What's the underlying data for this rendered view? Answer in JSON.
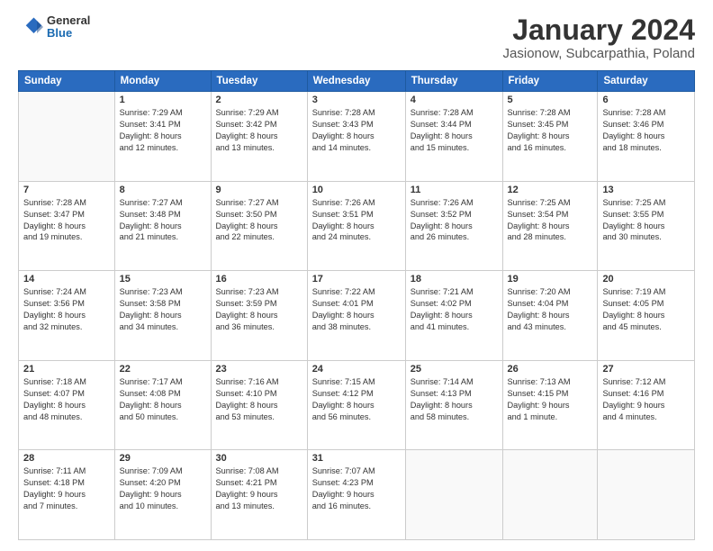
{
  "header": {
    "logo_general": "General",
    "logo_blue": "Blue",
    "title": "January 2024",
    "location": "Jasionow, Subcarpathia, Poland"
  },
  "columns": [
    "Sunday",
    "Monday",
    "Tuesday",
    "Wednesday",
    "Thursday",
    "Friday",
    "Saturday"
  ],
  "weeks": [
    [
      {
        "day": "",
        "info": ""
      },
      {
        "day": "1",
        "info": "Sunrise: 7:29 AM\nSunset: 3:41 PM\nDaylight: 8 hours\nand 12 minutes."
      },
      {
        "day": "2",
        "info": "Sunrise: 7:29 AM\nSunset: 3:42 PM\nDaylight: 8 hours\nand 13 minutes."
      },
      {
        "day": "3",
        "info": "Sunrise: 7:28 AM\nSunset: 3:43 PM\nDaylight: 8 hours\nand 14 minutes."
      },
      {
        "day": "4",
        "info": "Sunrise: 7:28 AM\nSunset: 3:44 PM\nDaylight: 8 hours\nand 15 minutes."
      },
      {
        "day": "5",
        "info": "Sunrise: 7:28 AM\nSunset: 3:45 PM\nDaylight: 8 hours\nand 16 minutes."
      },
      {
        "day": "6",
        "info": "Sunrise: 7:28 AM\nSunset: 3:46 PM\nDaylight: 8 hours\nand 18 minutes."
      }
    ],
    [
      {
        "day": "7",
        "info": "Sunrise: 7:28 AM\nSunset: 3:47 PM\nDaylight: 8 hours\nand 19 minutes."
      },
      {
        "day": "8",
        "info": "Sunrise: 7:27 AM\nSunset: 3:48 PM\nDaylight: 8 hours\nand 21 minutes."
      },
      {
        "day": "9",
        "info": "Sunrise: 7:27 AM\nSunset: 3:50 PM\nDaylight: 8 hours\nand 22 minutes."
      },
      {
        "day": "10",
        "info": "Sunrise: 7:26 AM\nSunset: 3:51 PM\nDaylight: 8 hours\nand 24 minutes."
      },
      {
        "day": "11",
        "info": "Sunrise: 7:26 AM\nSunset: 3:52 PM\nDaylight: 8 hours\nand 26 minutes."
      },
      {
        "day": "12",
        "info": "Sunrise: 7:25 AM\nSunset: 3:54 PM\nDaylight: 8 hours\nand 28 minutes."
      },
      {
        "day": "13",
        "info": "Sunrise: 7:25 AM\nSunset: 3:55 PM\nDaylight: 8 hours\nand 30 minutes."
      }
    ],
    [
      {
        "day": "14",
        "info": "Sunrise: 7:24 AM\nSunset: 3:56 PM\nDaylight: 8 hours\nand 32 minutes."
      },
      {
        "day": "15",
        "info": "Sunrise: 7:23 AM\nSunset: 3:58 PM\nDaylight: 8 hours\nand 34 minutes."
      },
      {
        "day": "16",
        "info": "Sunrise: 7:23 AM\nSunset: 3:59 PM\nDaylight: 8 hours\nand 36 minutes."
      },
      {
        "day": "17",
        "info": "Sunrise: 7:22 AM\nSunset: 4:01 PM\nDaylight: 8 hours\nand 38 minutes."
      },
      {
        "day": "18",
        "info": "Sunrise: 7:21 AM\nSunset: 4:02 PM\nDaylight: 8 hours\nand 41 minutes."
      },
      {
        "day": "19",
        "info": "Sunrise: 7:20 AM\nSunset: 4:04 PM\nDaylight: 8 hours\nand 43 minutes."
      },
      {
        "day": "20",
        "info": "Sunrise: 7:19 AM\nSunset: 4:05 PM\nDaylight: 8 hours\nand 45 minutes."
      }
    ],
    [
      {
        "day": "21",
        "info": "Sunrise: 7:18 AM\nSunset: 4:07 PM\nDaylight: 8 hours\nand 48 minutes."
      },
      {
        "day": "22",
        "info": "Sunrise: 7:17 AM\nSunset: 4:08 PM\nDaylight: 8 hours\nand 50 minutes."
      },
      {
        "day": "23",
        "info": "Sunrise: 7:16 AM\nSunset: 4:10 PM\nDaylight: 8 hours\nand 53 minutes."
      },
      {
        "day": "24",
        "info": "Sunrise: 7:15 AM\nSunset: 4:12 PM\nDaylight: 8 hours\nand 56 minutes."
      },
      {
        "day": "25",
        "info": "Sunrise: 7:14 AM\nSunset: 4:13 PM\nDaylight: 8 hours\nand 58 minutes."
      },
      {
        "day": "26",
        "info": "Sunrise: 7:13 AM\nSunset: 4:15 PM\nDaylight: 9 hours\nand 1 minute."
      },
      {
        "day": "27",
        "info": "Sunrise: 7:12 AM\nSunset: 4:16 PM\nDaylight: 9 hours\nand 4 minutes."
      }
    ],
    [
      {
        "day": "28",
        "info": "Sunrise: 7:11 AM\nSunset: 4:18 PM\nDaylight: 9 hours\nand 7 minutes."
      },
      {
        "day": "29",
        "info": "Sunrise: 7:09 AM\nSunset: 4:20 PM\nDaylight: 9 hours\nand 10 minutes."
      },
      {
        "day": "30",
        "info": "Sunrise: 7:08 AM\nSunset: 4:21 PM\nDaylight: 9 hours\nand 13 minutes."
      },
      {
        "day": "31",
        "info": "Sunrise: 7:07 AM\nSunset: 4:23 PM\nDaylight: 9 hours\nand 16 minutes."
      },
      {
        "day": "",
        "info": ""
      },
      {
        "day": "",
        "info": ""
      },
      {
        "day": "",
        "info": ""
      }
    ]
  ]
}
